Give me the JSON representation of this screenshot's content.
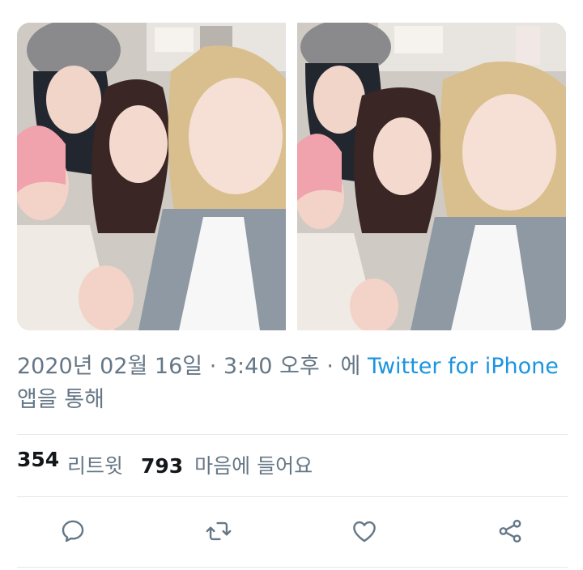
{
  "tweet": {
    "timestamp": "2020년 02월 16일 · 3:40 오후 · 에",
    "client_link": "Twitter for iPhone",
    "client_suffix": "앱을 통해"
  },
  "stats": {
    "retweets": "354",
    "retweets_label": "리트윗",
    "likes": "793",
    "likes_label": "마음에 들어요"
  },
  "actions": {
    "reply_icon": "reply-icon",
    "retweet_icon": "retweet-icon",
    "like_icon": "heart-icon",
    "share_icon": "share-icon"
  },
  "colors": {
    "link": "#1b95e0",
    "meta_text": "#657786",
    "icon": "#657786",
    "divider": "#e1e8ed"
  }
}
